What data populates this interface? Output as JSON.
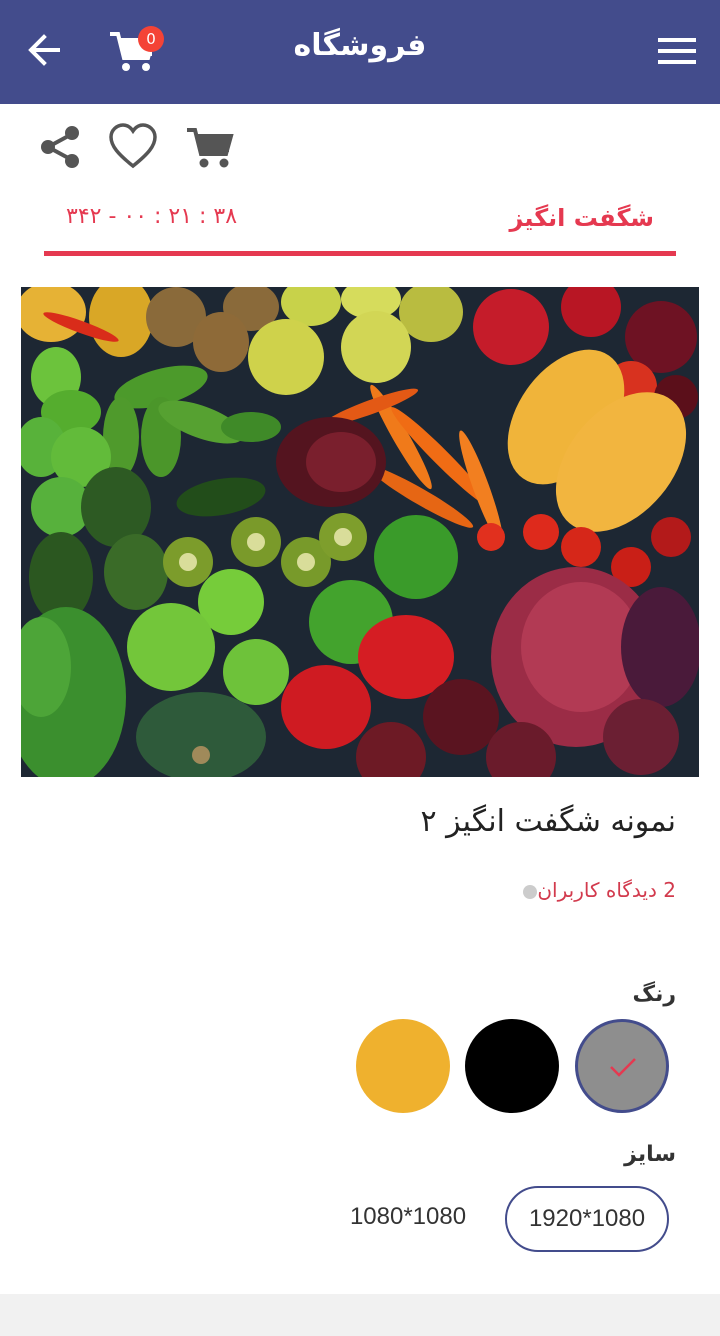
{
  "appbar": {
    "title": "فروشگاه",
    "cart_count": "0",
    "icons": [
      "back-arrow-icon",
      "cart-icon",
      "hamburger-menu-icon"
    ]
  },
  "actions": [
    "share-icon",
    "heart-icon",
    "add-to-cart-icon"
  ],
  "brand": "شگفت انگیز",
  "timer": "۳۴۲ - ۰۰ : ۲۱ : ۳۸",
  "product": {
    "title": "نمونه شگفت انگیز ۲",
    "reviews": "2 دیدگاه کاربران"
  },
  "color": {
    "label": "رنگ",
    "options": [
      "#8e8e8e",
      "#000000",
      "#efb12e"
    ],
    "selected": "#8e8e8e"
  },
  "size": {
    "label": "سایز",
    "options": [
      "1920*1080",
      "1080*1080"
    ],
    "selected": "1920*1080"
  },
  "colors": {
    "primary": "#434c8c",
    "accent": "#e53950",
    "badge": "#f44336"
  }
}
